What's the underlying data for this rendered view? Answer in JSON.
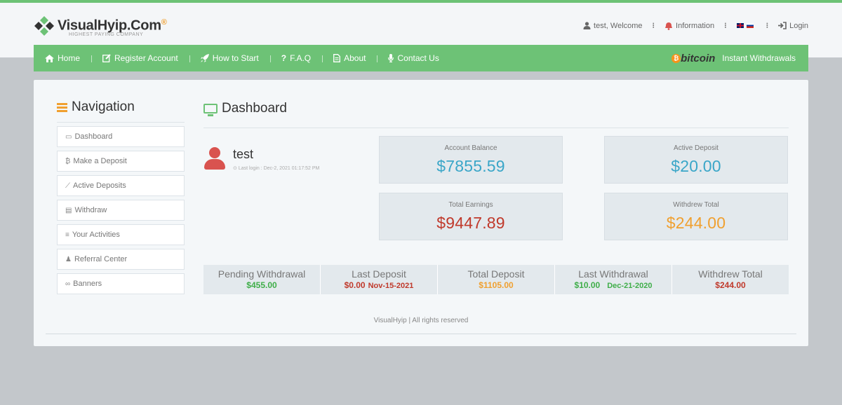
{
  "colors": {
    "green": "#6dc276",
    "blue": "#3aa6c8",
    "red": "#c0392b",
    "orange": "#f0a030",
    "darkred": "#d9534f"
  },
  "logo": {
    "title": "VisualHyip.Com",
    "badge": "®",
    "subtitle": "HIGHEST PAYING COMPANY"
  },
  "topbar": {
    "user": "test, Welcome",
    "info": "Information",
    "login": "Login"
  },
  "nav": {
    "items": [
      {
        "label": "Home",
        "icon": "home-icon"
      },
      {
        "label": "Register Account",
        "icon": "edit-icon"
      },
      {
        "label": "How to Start",
        "icon": "rocket-icon"
      },
      {
        "label": "F.A.Q",
        "icon": "question-icon"
      },
      {
        "label": "About",
        "icon": "document-icon"
      },
      {
        "label": "Contact Us",
        "icon": "microphone-icon"
      }
    ],
    "bitcoin": "bitcoin",
    "withdrawals": "Instant Withdrawals"
  },
  "sidebar": {
    "title": "Navigation",
    "items": [
      {
        "label": "Dashboard",
        "icon": "monitor-icon"
      },
      {
        "label": "Make a Deposit",
        "icon": "bitcoin-icon"
      },
      {
        "label": "Active Deposits",
        "icon": "line-chart-icon"
      },
      {
        "label": "Withdraw",
        "icon": "credit-card-icon"
      },
      {
        "label": "Your Activities",
        "icon": "sliders-icon"
      },
      {
        "label": "Referral Center",
        "icon": "users-icon"
      },
      {
        "label": "Banners",
        "icon": "link-icon"
      }
    ]
  },
  "dashboard": {
    "title": "Dashboard",
    "username": "test",
    "last_login": "Last login : Dec-2, 2021 01:17:52 PM",
    "stats": {
      "account_balance": {
        "label": "Account Balance",
        "value": "$7855.59"
      },
      "active_deposit": {
        "label": "Active Deposit",
        "value": "$20.00"
      },
      "total_earnings": {
        "label": "Total Earnings",
        "value": "$9447.89"
      },
      "withdrew_total": {
        "label": "Withdrew Total",
        "value": "$244.00"
      }
    },
    "summary": {
      "pending_withdrawal": {
        "label": "Pending Withdrawal",
        "value": "$455.00"
      },
      "last_deposit": {
        "label": "Last Deposit",
        "value": "$0.00",
        "date": "Nov-15-2021"
      },
      "total_deposit": {
        "label": "Total Deposit",
        "value": "$1105.00"
      },
      "last_withdrawal": {
        "label": "Last Withdrawal",
        "value": "$10.00",
        "date": "Dec-21-2020"
      },
      "withdrew_total": {
        "label": "Withdrew Total",
        "value": "$244.00"
      }
    }
  },
  "footer": {
    "copyright": "VisualHyip | All rights reserved"
  }
}
